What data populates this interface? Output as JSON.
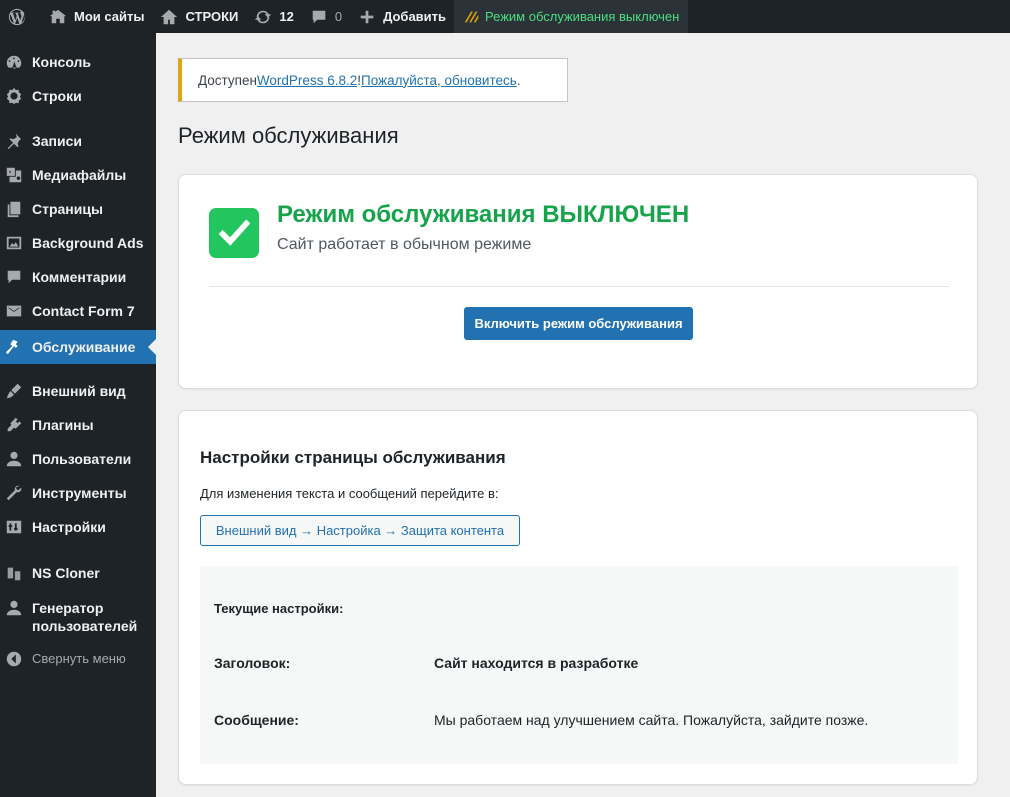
{
  "admin_bar": {
    "my_sites": "Мои сайты",
    "site_name": "СТРОКИ",
    "updates_count": "12",
    "comments_count": "0",
    "add_new": "Добавить",
    "maintenance_status": "Режим обслуживания выключен"
  },
  "sidebar": {
    "items": [
      {
        "label": "Консоль",
        "icon": "dashboard-icon"
      },
      {
        "label": "Строки",
        "icon": "gear-icon"
      },
      {
        "label": "Записи",
        "icon": "pin-icon"
      },
      {
        "label": "Медиафайлы",
        "icon": "media-icon"
      },
      {
        "label": "Страницы",
        "icon": "pages-icon"
      },
      {
        "label": "Background Ads",
        "icon": "image-icon"
      },
      {
        "label": "Комментарии",
        "icon": "comment-icon"
      },
      {
        "label": "Contact Form 7",
        "icon": "mail-icon"
      },
      {
        "label": "Обслуживание",
        "icon": "hammer-icon"
      },
      {
        "label": "Внешний вид",
        "icon": "brush-icon"
      },
      {
        "label": "Плагины",
        "icon": "plugin-icon"
      },
      {
        "label": "Пользователи",
        "icon": "user-icon"
      },
      {
        "label": "Инструменты",
        "icon": "wrench-icon"
      },
      {
        "label": "Настройки",
        "icon": "settings-icon"
      },
      {
        "label": "NS Cloner",
        "icon": "cloner-icon"
      },
      {
        "label": "Генератор пользователей",
        "icon": "user-icon"
      },
      {
        "label": "Свернуть меню",
        "icon": "collapse-icon"
      }
    ],
    "active": "Обслуживание"
  },
  "notice": {
    "prefix": "Доступен ",
    "version_link": "WordPress 6.8.2",
    "middle": "! ",
    "update_link": "Пожалуйста, обновитесь",
    "suffix": "."
  },
  "page_title": "Режим обслуживания",
  "status_card": {
    "title": "Режим обслуживания ВЫКЛЮЧЕН",
    "subtitle": "Сайт работает в обычном режиме",
    "enable_button": "Включить режим обслуживания"
  },
  "settings_card": {
    "title": "Настройки страницы обслуживания",
    "description": "Для изменения текста и сообщений перейдите в:",
    "path_button": "Внешний вид → Настройка → Защита контента",
    "current_heading": "Текущие настройки:",
    "rows": [
      {
        "label": "Заголовок:",
        "value": "Сайт находится в разработке"
      },
      {
        "label": "Сообщение:",
        "value": "Мы работаем над улучшением сайта. Пожалуйста, зайдите позже."
      }
    ]
  },
  "colors": {
    "admin_bg": "#1d2327",
    "accent": "#2271b1",
    "success": "#16a34a",
    "notice_border": "#dba617",
    "maint_status_text": "#4ade80"
  }
}
